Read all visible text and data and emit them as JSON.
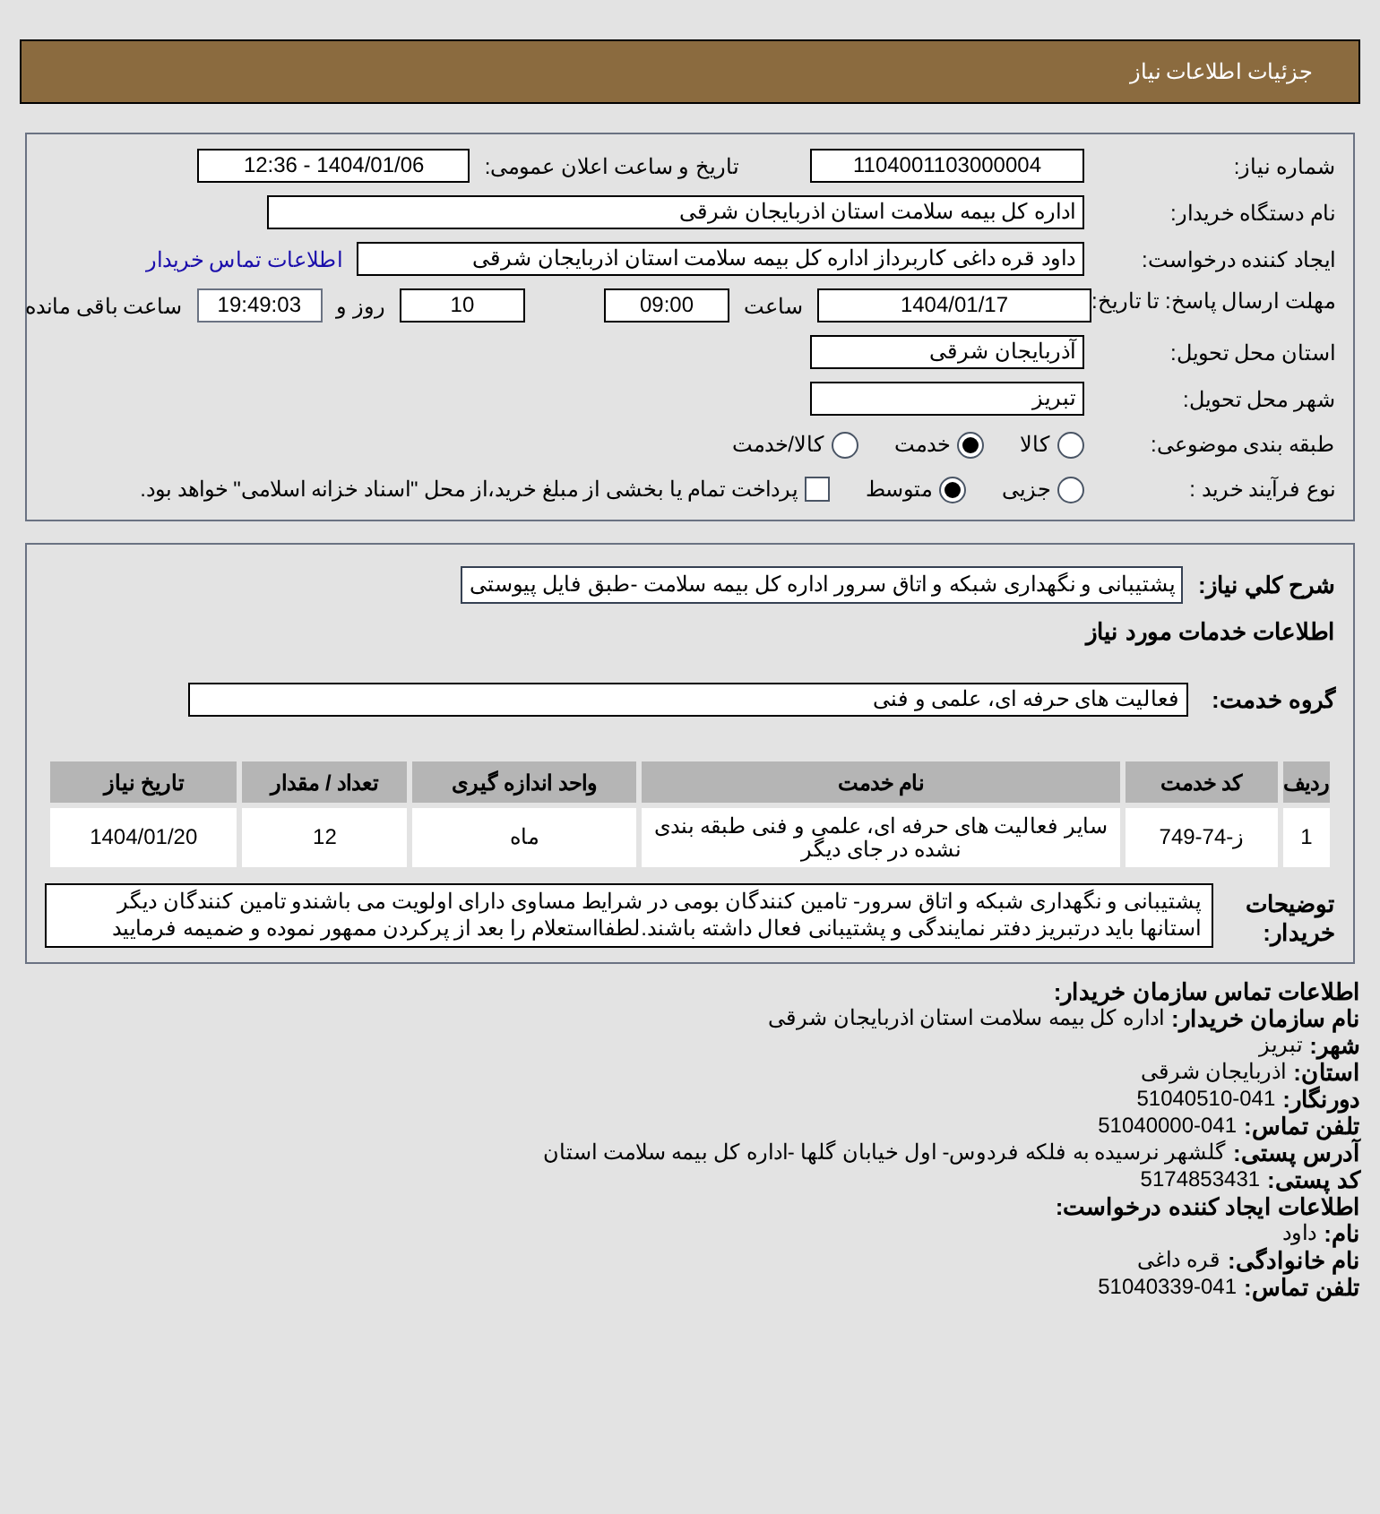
{
  "header": {
    "title": "جزئیات اطلاعات نیاز"
  },
  "need_number": {
    "label": "شماره نیاز:",
    "value": "1104001103000004"
  },
  "announce": {
    "label": "تاریخ و ساعت اعلان عمومی:",
    "value": "1404/01/06 - 12:36"
  },
  "buyer": {
    "label": "نام دستگاه خریدار:",
    "value": "اداره کل بیمه سلامت استان اذربایجان شرقی"
  },
  "creator": {
    "label": "ایجاد کننده درخواست:",
    "value": "داود قره داغی کاربرداز اداره کل بیمه سلامت استان اذربایجان شرقی",
    "link": "اطلاعات تماس خریدار"
  },
  "deadline": {
    "label": "مهلت ارسال پاسخ: تا تاریخ:",
    "date": "1404/01/17",
    "time_label": "ساعت",
    "time": "09:00",
    "days": "10",
    "days_label": "روز و",
    "remaining": "19:49:03",
    "remaining_label": "ساعت باقی مانده"
  },
  "province": {
    "label": "استان محل تحویل:",
    "value": "آذربایجان شرقی"
  },
  "city": {
    "label": "شهر محل تحویل:",
    "value": "تبریز"
  },
  "category": {
    "label": "طبقه بندی موضوعی:",
    "options": [
      {
        "label": "کالا",
        "selected": false
      },
      {
        "label": "خدمت",
        "selected": true
      },
      {
        "label": "کالا/خدمت",
        "selected": false
      }
    ]
  },
  "process": {
    "label": "نوع فرآیند خرید :",
    "options": [
      {
        "label": "جزیی",
        "selected": false
      },
      {
        "label": "متوسط",
        "selected": true
      }
    ],
    "payment": {
      "label": "پرداخت تمام یا بخشی از مبلغ خرید،از محل \"اسناد خزانه اسلامی\" خواهد بود.",
      "checked": false
    }
  },
  "description": {
    "label": "شرح کلي نياز:",
    "value": "پشتیبانی و نگهداری شبکه و اتاق سرور اداره کل بیمه سلامت -طبق فایل پیوستی"
  },
  "services_heading": "اطلاعات خدمات مورد نیاز",
  "service_group": {
    "label": "گروه خدمت:",
    "value": "فعالیت های حرفه ای، علمی و فنی"
  },
  "table": {
    "columns": [
      "ردیف",
      "کد خدمت",
      "نام خدمت",
      "واحد اندازه گیری",
      "تعداد / مقدار",
      "تاریخ نیاز"
    ],
    "rows": [
      [
        "1",
        "ز-74-749",
        "سایر فعالیت های حرفه ای، علمی و فنی طبقه بندی نشده در جای دیگر",
        "ماه",
        "12",
        "1404/01/20"
      ]
    ]
  },
  "buyer_notes": {
    "label": "توضیحات خریدار:",
    "value": "پشتیبانی و نگهداری شبکه و اتاق سرور- تامین کنندگان بومی در شرایط مساوی دارای اولویت می باشندو تامین کنندگان دیگر استانها باید درتبریز دفتر نمایندگی و پشتیبانی فعال داشته باشند.لطفااستعلام را بعد از پرکردن ممهور نموده و ضمیمه فرمایید"
  },
  "contact": [
    {
      "kind": "heading",
      "label": "اطلاعات تماس سازمان خریدار:"
    },
    {
      "kind": "line",
      "label": "نام سازمان خریدار:",
      "value": "اداره کل بیمه سلامت استان اذربایجان شرقی"
    },
    {
      "kind": "line",
      "label": "شهر:",
      "value": "تبریز"
    },
    {
      "kind": "line",
      "label": "استان:",
      "value": "اذربایجان شرقی"
    },
    {
      "kind": "line",
      "label": "دورنگار:",
      "value": "51040510-041"
    },
    {
      "kind": "line",
      "label": "تلفن تماس:",
      "value": "51040000-041"
    },
    {
      "kind": "line",
      "label": "آدرس پستی:",
      "value": "گلشهر نرسیده به فلکه فردوس- اول خیابان گلها -اداره کل بیمه سلامت استان"
    },
    {
      "kind": "line",
      "label": "کد پستی:",
      "value": "5174853431"
    },
    {
      "kind": "heading",
      "label": "اطلاعات ایجاد کننده درخواست:"
    },
    {
      "kind": "line",
      "label": "نام:",
      "value": "داود"
    },
    {
      "kind": "line",
      "label": "نام خانوادگی:",
      "value": "قره داغی"
    },
    {
      "kind": "line",
      "label": "تلفن تماس:",
      "value": "51040339-041"
    }
  ]
}
